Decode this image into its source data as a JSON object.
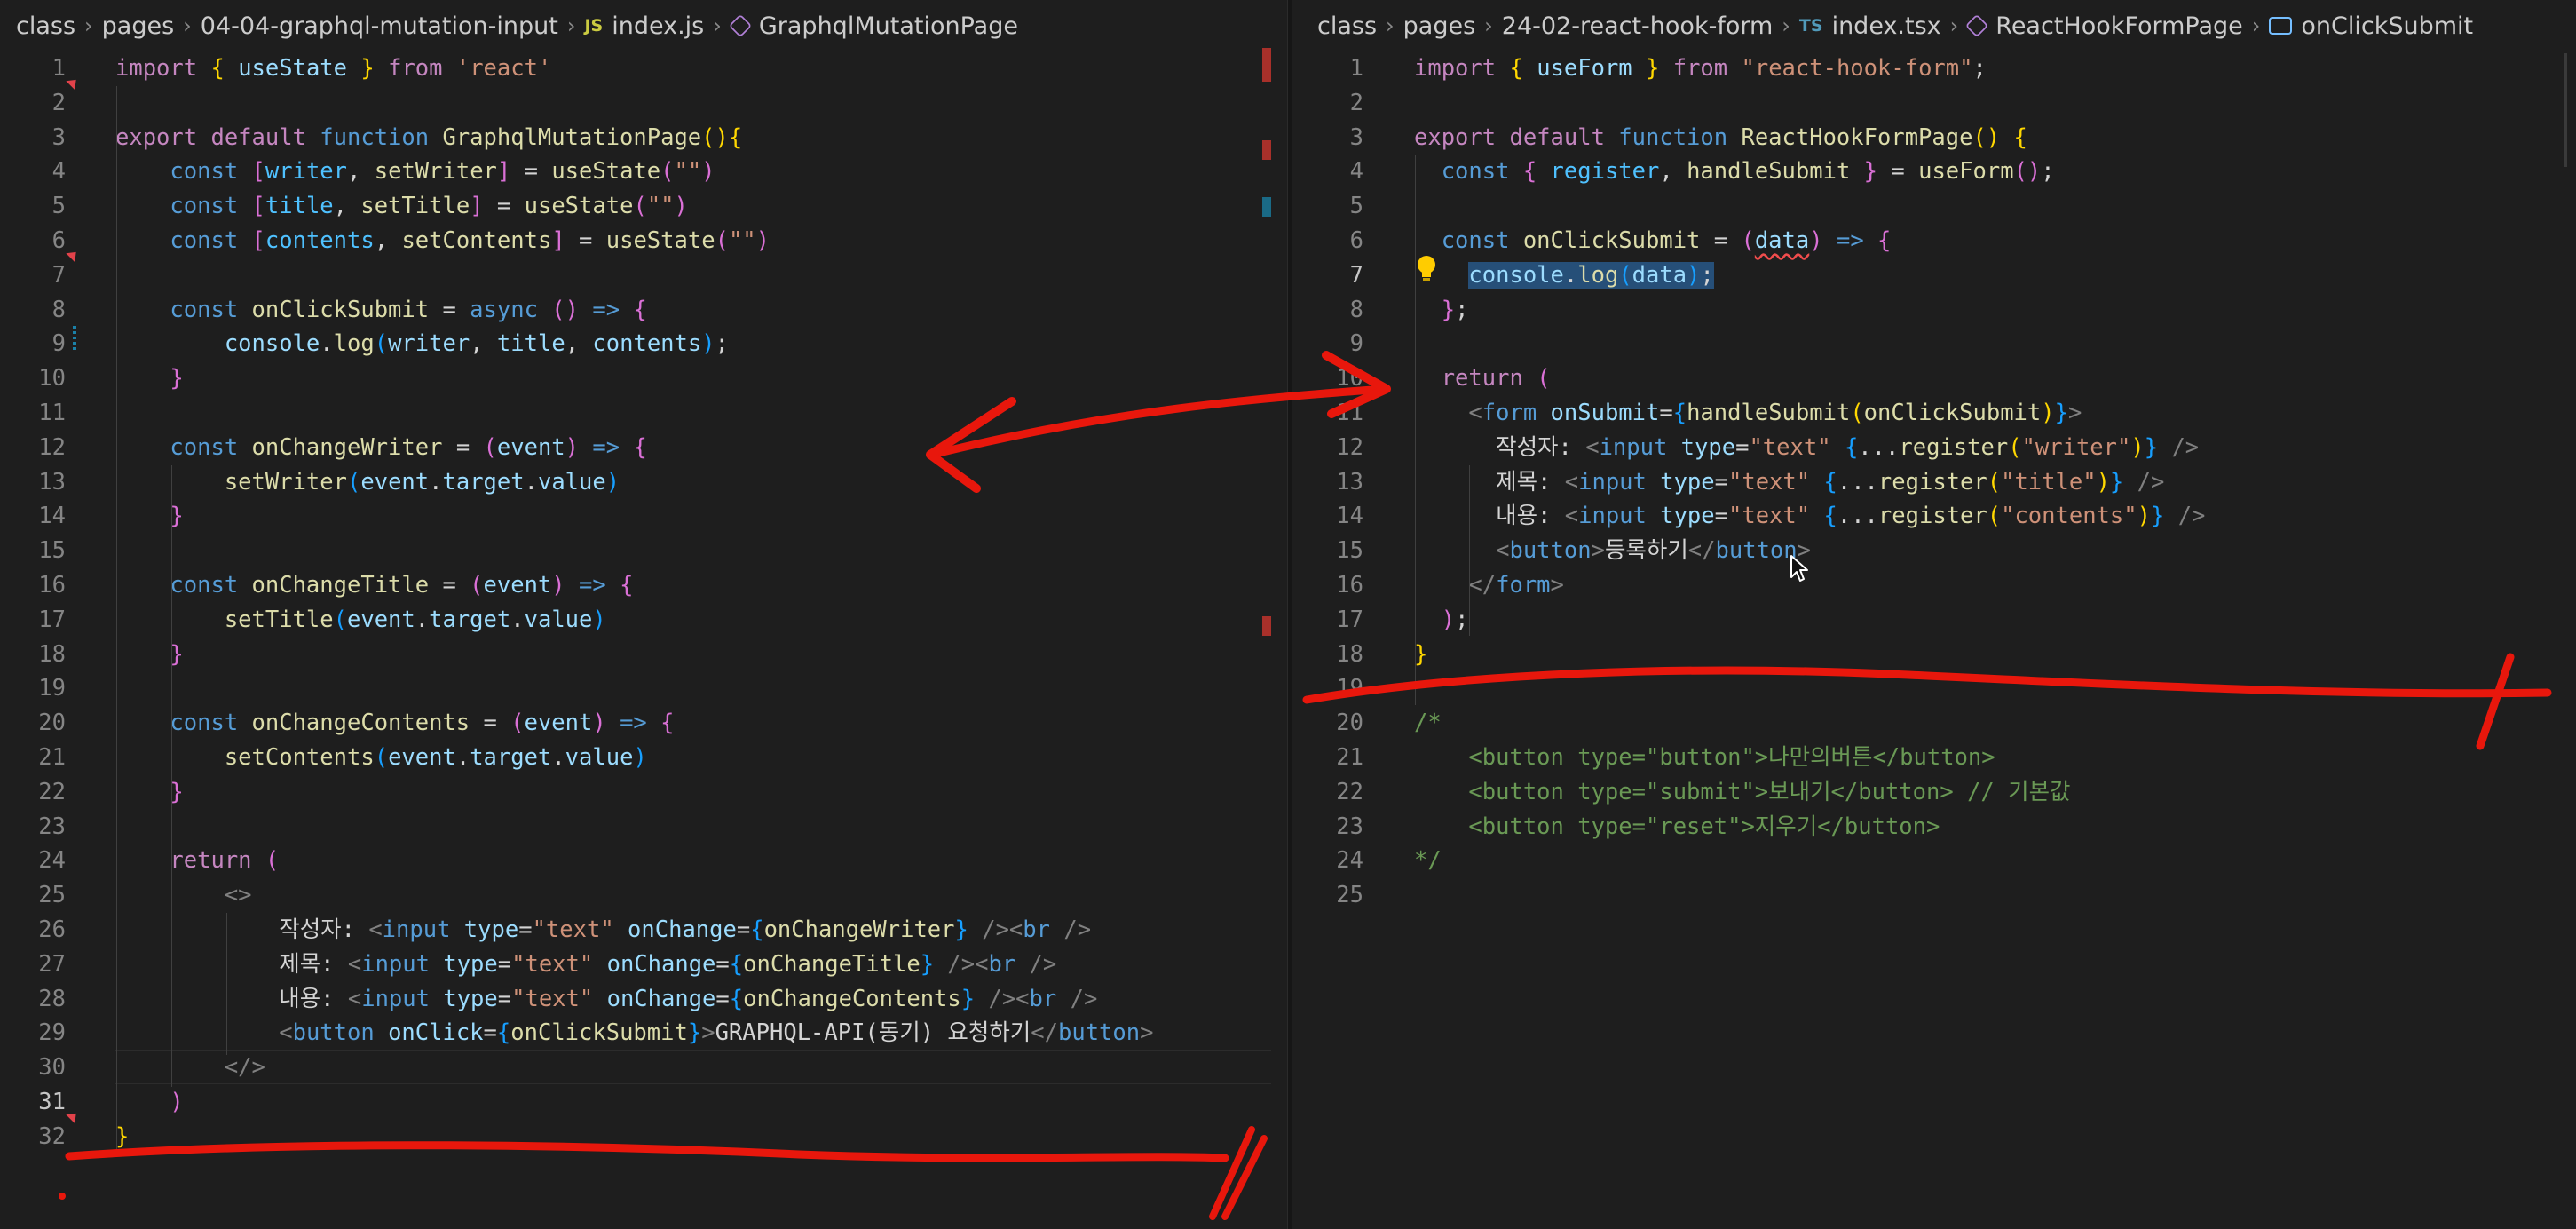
{
  "left": {
    "breadcrumb": {
      "crumbs": [
        "class",
        "pages",
        "04-04-graphql-mutation-input"
      ],
      "file_badge": "JS",
      "file": "index.js",
      "symbol": "GraphqlMutationPage"
    },
    "line_numbers": [
      "1",
      "2",
      "3",
      "4",
      "5",
      "6",
      "7",
      "8",
      "9",
      "10",
      "11",
      "12",
      "13",
      "14",
      "15",
      "16",
      "17",
      "18",
      "19",
      "20",
      "21",
      "22",
      "23",
      "24",
      "25",
      "26",
      "27",
      "28",
      "29",
      "30",
      "31",
      "32"
    ],
    "active_line": "31"
  },
  "right": {
    "breadcrumb": {
      "crumbs": [
        "class",
        "pages",
        "24-02-react-hook-form"
      ],
      "file_badge": "TS",
      "file": "index.tsx",
      "symbol": "ReactHookFormPage",
      "sub_symbol": "onClickSubmit"
    },
    "line_numbers": [
      "1",
      "2",
      "3",
      "4",
      "5",
      "6",
      "7",
      "8",
      "9",
      "10",
      "11",
      "12",
      "13",
      "14",
      "15",
      "16",
      "17",
      "18",
      "19",
      "20",
      "21",
      "22",
      "23",
      "24",
      "25"
    ],
    "active_line": "7"
  },
  "colors": {
    "background": "#1e1e1e",
    "keyword": "#569cd6",
    "control": "#c586c0",
    "function": "#dcdcaa",
    "variable": "#9cdcfe",
    "string": "#ce9178",
    "comment": "#6a9955",
    "annotation_red": "#e8170c"
  }
}
